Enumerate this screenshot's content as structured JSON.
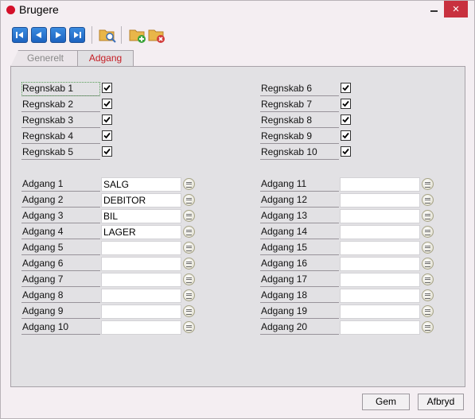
{
  "window": {
    "title": "Brugere",
    "close_glyph": "×"
  },
  "toolbar": {
    "icons": [
      "first-record-icon",
      "previous-record-icon",
      "next-record-icon",
      "last-record-icon",
      "search-folder-icon",
      "add-folder-icon",
      "delete-folder-icon"
    ]
  },
  "tabs": [
    {
      "label": "Generelt",
      "active": false
    },
    {
      "label": "Adgang",
      "active": true
    }
  ],
  "regnskab": [
    {
      "label": "Regnskab 1",
      "checked": true
    },
    {
      "label": "Regnskab 2",
      "checked": true
    },
    {
      "label": "Regnskab 3",
      "checked": true
    },
    {
      "label": "Regnskab 4",
      "checked": true
    },
    {
      "label": "Regnskab 5",
      "checked": true
    },
    {
      "label": "Regnskab 6",
      "checked": true
    },
    {
      "label": "Regnskab 7",
      "checked": true
    },
    {
      "label": "Regnskab 8",
      "checked": true
    },
    {
      "label": "Regnskab 9",
      "checked": true
    },
    {
      "label": "Regnskab 10",
      "checked": true
    }
  ],
  "adgang": [
    {
      "label": "Adgang 1",
      "value": "SALG"
    },
    {
      "label": "Adgang 2",
      "value": "DEBITOR"
    },
    {
      "label": "Adgang 3",
      "value": "BIL"
    },
    {
      "label": "Adgang 4",
      "value": "LAGER"
    },
    {
      "label": "Adgang 5",
      "value": ""
    },
    {
      "label": "Adgang 6",
      "value": ""
    },
    {
      "label": "Adgang 7",
      "value": ""
    },
    {
      "label": "Adgang 8",
      "value": ""
    },
    {
      "label": "Adgang 9",
      "value": ""
    },
    {
      "label": "Adgang 10",
      "value": ""
    },
    {
      "label": "Adgang 11",
      "value": ""
    },
    {
      "label": "Adgang 12",
      "value": ""
    },
    {
      "label": "Adgang 13",
      "value": ""
    },
    {
      "label": "Adgang 14",
      "value": ""
    },
    {
      "label": "Adgang 15",
      "value": ""
    },
    {
      "label": "Adgang 16",
      "value": ""
    },
    {
      "label": "Adgang 17",
      "value": ""
    },
    {
      "label": "Adgang 18",
      "value": ""
    },
    {
      "label": "Adgang 19",
      "value": ""
    },
    {
      "label": "Adgang 20",
      "value": ""
    }
  ],
  "buttons": {
    "save": "Gem",
    "cancel": "Afbryd"
  },
  "colors": {
    "accent": "#1d63c0",
    "active_tab_text": "#c51d24",
    "close": "#c8313f"
  }
}
